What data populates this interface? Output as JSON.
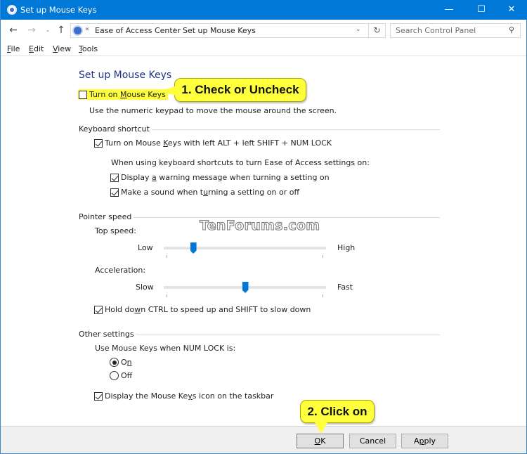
{
  "window": {
    "title": "Set up Mouse Keys",
    "controls": {
      "minimize": "—",
      "maximize": "☐",
      "close": "✕"
    }
  },
  "navbar": {
    "back_icon": "←",
    "forward_icon": "→",
    "recent_icon": "⌄",
    "up_icon": "↑",
    "address": {
      "overflow": "«",
      "crumbs": [
        "Ease of Access Center",
        "Set up Mouse Keys"
      ],
      "separator": "›",
      "dropdown_icon": "⌄",
      "refresh_icon": "↻"
    },
    "search": {
      "placeholder": "Search Control Panel",
      "value": "",
      "icon": "⚲"
    }
  },
  "menubar": {
    "items": [
      {
        "accel": "F",
        "rest": "ile"
      },
      {
        "accel": "E",
        "rest": "dit"
      },
      {
        "accel": "V",
        "rest": "iew"
      },
      {
        "accel": "T",
        "rest": "ools"
      }
    ]
  },
  "main": {
    "title": "Set up Mouse Keys",
    "turn_on": {
      "pre": "Turn on ",
      "accel": "M",
      "post": "ouse Keys",
      "checked": false
    },
    "turn_on_desc": "Use the numeric keypad to move the mouse around the screen.",
    "keyboard_shortcut": {
      "label": "Keyboard shortcut",
      "shortcut_cb": {
        "pre": "Turn on Mouse ",
        "accel": "K",
        "post": "eys with left ALT + left SHIFT + NUM LOCK",
        "checked": true
      },
      "sub_label": "When using keyboard shortcuts to turn Ease of Access settings on:",
      "warning_cb": {
        "pre": "Display ",
        "accel": "a",
        "post": " warning message when turning a setting on",
        "checked": true
      },
      "sound_cb": {
        "pre": "Make a sound when t",
        "accel": "u",
        "post": "rning a setting on or off",
        "checked": true
      }
    },
    "pointer_speed": {
      "label": "Pointer speed",
      "top_speed": {
        "label": "Top speed:",
        "min_label": "Low",
        "max_label": "High",
        "value": 0.18
      },
      "acceleration": {
        "label": "Acceleration:",
        "min_label": "Slow",
        "max_label": "Fast",
        "value": 0.5
      },
      "ctrl_shift_cb": {
        "pre": "Hold do",
        "accel": "w",
        "post": "n CTRL to speed up and SHIFT to slow down",
        "checked": true
      }
    },
    "other_settings": {
      "label": "Other settings",
      "numlock_label": "Use Mouse Keys when NUM LOCK is:",
      "radio_on": {
        "pre": "O",
        "accel": "n",
        "post": "",
        "selected": true
      },
      "radio_off": {
        "label": "Off",
        "selected": false
      },
      "taskbar_cb": {
        "pre": "Display the Mouse Ke",
        "accel": "y",
        "post": "s icon on the taskbar",
        "checked": true
      }
    }
  },
  "annotations": {
    "callout1": "1. Check or Uncheck",
    "callout2": "2. Click on",
    "watermark": "TenForums.com"
  },
  "footer": {
    "ok": {
      "accel": "O",
      "rest": "K"
    },
    "cancel": "Cancel",
    "apply": {
      "pre": "A",
      "accel": "p",
      "post": "ply"
    }
  }
}
